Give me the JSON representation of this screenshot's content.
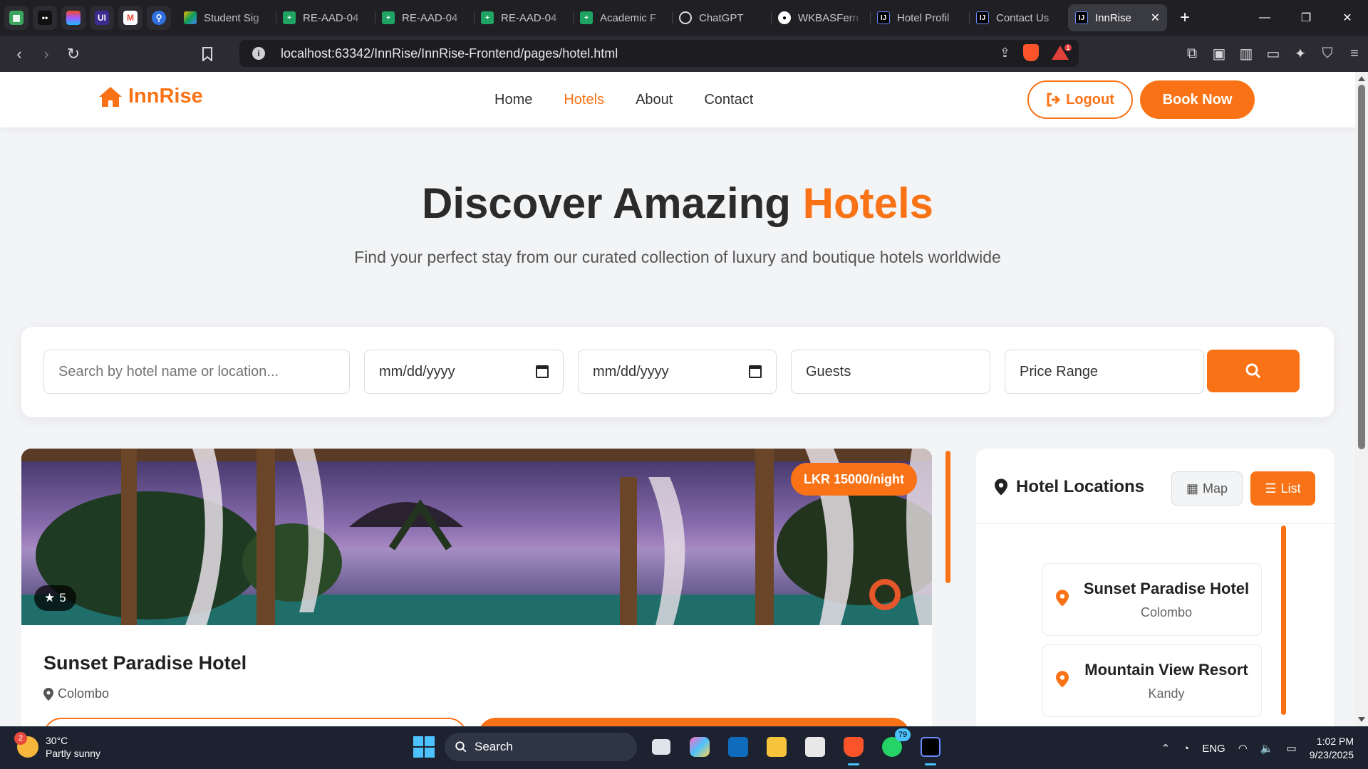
{
  "browser": {
    "pinned_tabs": [
      {
        "icon": "green-app-icon",
        "color": "#3aa55d"
      },
      {
        "icon": "dark-app-icon",
        "color": "#111111"
      },
      {
        "icon": "figma-icon",
        "color": "#f24e1e"
      },
      {
        "icon": "ui-icon",
        "color": "#3b2b8f"
      },
      {
        "icon": "gmail-icon",
        "color": "#ea4335"
      },
      {
        "icon": "link-icon",
        "color": "#2f6fe0"
      }
    ],
    "tabs": [
      {
        "title": "Student Sig",
        "icon": "drive-icon",
        "color": "#f4b400"
      },
      {
        "title": "RE-AAD-04",
        "icon": "sheets-icon",
        "color": "#1fa463"
      },
      {
        "title": "RE-AAD-04",
        "icon": "sheets-icon",
        "color": "#1fa463"
      },
      {
        "title": "RE-AAD-04",
        "icon": "sheets-icon",
        "color": "#1fa463"
      },
      {
        "title": "Academic F",
        "icon": "sheets-icon",
        "color": "#1fa463"
      },
      {
        "title": "ChatGPT",
        "icon": "chatgpt-icon",
        "color": "#2b2b31"
      },
      {
        "title": "WKBASFern",
        "icon": "github-icon",
        "color": "#2b2b31"
      },
      {
        "title": "Hotel Profil",
        "icon": "intellij-icon",
        "color": "#000000"
      },
      {
        "title": "Contact Us",
        "icon": "intellij-icon",
        "color": "#000000"
      },
      {
        "title": "InnRise",
        "icon": "intellij-icon",
        "color": "#000000",
        "active": true
      }
    ],
    "url": "localhost:63342/InnRise/InnRise-Frontend/pages/hotel.html",
    "notification_count": "1"
  },
  "site": {
    "brand": "InnRise",
    "accent_color": "#f97316",
    "nav": [
      "Home",
      "Hotels",
      "About",
      "Contact"
    ],
    "active_nav": "Hotels",
    "logout_label": "Logout",
    "book_label": "Book Now"
  },
  "hero": {
    "title_prefix": "Discover Amazing",
    "title_highlight": "Hotels",
    "subtitle": "Find your perfect stay from our curated collection of luxury and boutique hotels worldwide"
  },
  "search": {
    "text_placeholder": "Search by hotel name or location...",
    "checkin_value": "mm/dd/yyyy",
    "checkout_value": "mm/dd/yyyy",
    "guests_value": "Guests",
    "price_value": "Price Range"
  },
  "hotel_card": {
    "price": "LKR 15000/night",
    "rating": "5",
    "name": "Sunset Paradise Hotel",
    "location": "Colombo"
  },
  "locations": {
    "title": "Hotel Locations",
    "map_label": "Map",
    "list_label": "List",
    "items": [
      {
        "name": "Sunset Paradise Hotel",
        "city": "Colombo"
      },
      {
        "name": "Mountain View Resort",
        "city": "Kandy"
      }
    ]
  },
  "taskbar": {
    "weather_temp": "30°C",
    "weather_desc": "Partly sunny",
    "weather_badge": "2",
    "search_label": "Search",
    "whatsapp_badge": "79",
    "lang": "ENG",
    "time": "1:02 PM",
    "date": "9/23/2025"
  }
}
